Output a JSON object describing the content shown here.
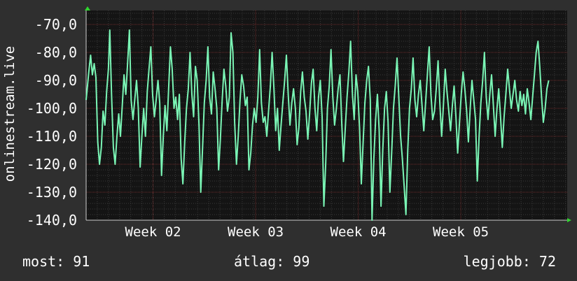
{
  "chart_data": {
    "type": "line",
    "ylabel": "onlinestream.live",
    "y_ticks": [
      -70,
      -80,
      -90,
      -100,
      -110,
      -120,
      -130,
      -140
    ],
    "y_tick_labels": [
      "-70,0",
      "-80,0",
      "-90,0",
      "-100,0",
      "-110,0",
      "-120,0",
      "-130,0",
      "-140,0"
    ],
    "ylim": [
      -140,
      -65
    ],
    "x_range": [
      0,
      100
    ],
    "x_ticks": [
      {
        "x": 15,
        "label": "Week 02"
      },
      {
        "x": 38,
        "label": "Week 03"
      },
      {
        "x": 61,
        "label": "Week 04"
      },
      {
        "x": 84,
        "label": "Week 05"
      }
    ],
    "grid": true,
    "series": [
      {
        "color": "#7af5b5",
        "points": [
          [
            0,
            -97
          ],
          [
            0.6,
            -87
          ],
          [
            1.0,
            -81
          ],
          [
            1.4,
            -88
          ],
          [
            1.8,
            -84
          ],
          [
            2.2,
            -89
          ],
          [
            2.6,
            -112
          ],
          [
            3.0,
            -120
          ],
          [
            3.4,
            -114
          ],
          [
            3.8,
            -101
          ],
          [
            4.2,
            -106
          ],
          [
            4.6,
            -94
          ],
          [
            5.0,
            -86
          ],
          [
            5.3,
            -72
          ],
          [
            5.7,
            -95
          ],
          [
            6.1,
            -114
          ],
          [
            6.5,
            -120
          ],
          [
            6.9,
            -110
          ],
          [
            7.3,
            -102
          ],
          [
            7.7,
            -110
          ],
          [
            8.1,
            -99
          ],
          [
            8.5,
            -88
          ],
          [
            8.9,
            -95
          ],
          [
            9.3,
            -84
          ],
          [
            9.7,
            -72
          ],
          [
            10.1,
            -97
          ],
          [
            10.5,
            -104
          ],
          [
            10.9,
            -97
          ],
          [
            11.3,
            -90
          ],
          [
            11.7,
            -100
          ],
          [
            12.1,
            -121
          ],
          [
            12.5,
            -110
          ],
          [
            12.9,
            -100
          ],
          [
            13.3,
            -110
          ],
          [
            13.7,
            -94
          ],
          [
            14.1,
            -86
          ],
          [
            14.5,
            -78
          ],
          [
            14.9,
            -95
          ],
          [
            15.3,
            -103
          ],
          [
            15.7,
            -97
          ],
          [
            16.1,
            -90
          ],
          [
            16.5,
            -98
          ],
          [
            16.9,
            -124
          ],
          [
            17.3,
            -110
          ],
          [
            17.7,
            -99
          ],
          [
            18.1,
            -108
          ],
          [
            18.5,
            -93
          ],
          [
            18.9,
            -78
          ],
          [
            19.3,
            -86
          ],
          [
            19.7,
            -100
          ],
          [
            20.1,
            -96
          ],
          [
            20.5,
            -104
          ],
          [
            20.9,
            -95
          ],
          [
            21.3,
            -118
          ],
          [
            21.7,
            -127
          ],
          [
            22.1,
            -112
          ],
          [
            22.5,
            -100
          ],
          [
            22.9,
            -93
          ],
          [
            23.3,
            -80
          ],
          [
            23.7,
            -95
          ],
          [
            24.1,
            -103
          ],
          [
            24.5,
            -85
          ],
          [
            24.9,
            -90
          ],
          [
            25.3,
            -106
          ],
          [
            25.7,
            -130
          ],
          [
            26.1,
            -114
          ],
          [
            26.5,
            -98
          ],
          [
            26.9,
            -90
          ],
          [
            27.3,
            -78
          ],
          [
            27.7,
            -96
          ],
          [
            28.1,
            -102
          ],
          [
            28.5,
            -87
          ],
          [
            28.9,
            -93
          ],
          [
            29.3,
            -100
          ],
          [
            29.7,
            -122
          ],
          [
            30.1,
            -111
          ],
          [
            30.5,
            -97
          ],
          [
            30.9,
            -86
          ],
          [
            31.3,
            -92
          ],
          [
            31.7,
            -101
          ],
          [
            32.1,
            -96
          ],
          [
            32.5,
            -73
          ],
          [
            32.9,
            -80
          ],
          [
            33.3,
            -105
          ],
          [
            33.7,
            -120
          ],
          [
            34.1,
            -110
          ],
          [
            34.5,
            -97
          ],
          [
            34.9,
            -88
          ],
          [
            35.3,
            -92
          ],
          [
            35.7,
            -99
          ],
          [
            36.1,
            -96
          ],
          [
            36.5,
            -122
          ],
          [
            36.9,
            -116
          ],
          [
            37.3,
            -106
          ],
          [
            37.7,
            -100
          ],
          [
            38.1,
            -105
          ],
          [
            38.5,
            -96
          ],
          [
            38.9,
            -79
          ],
          [
            39.3,
            -98
          ],
          [
            39.7,
            -105
          ],
          [
            40.1,
            -103
          ],
          [
            40.5,
            -110
          ],
          [
            40.9,
            -101
          ],
          [
            41.3,
            -92
          ],
          [
            41.7,
            -80
          ],
          [
            42.1,
            -93
          ],
          [
            42.5,
            -108
          ],
          [
            42.9,
            -100
          ],
          [
            43.3,
            -115
          ],
          [
            43.7,
            -106
          ],
          [
            44.1,
            -98
          ],
          [
            44.5,
            -90
          ],
          [
            44.9,
            -81
          ],
          [
            45.3,
            -95
          ],
          [
            45.7,
            -106
          ],
          [
            46.1,
            -98
          ],
          [
            46.5,
            -93
          ],
          [
            46.9,
            -100
          ],
          [
            47.3,
            -113
          ],
          [
            47.7,
            -107
          ],
          [
            48.1,
            -94
          ],
          [
            48.5,
            -87
          ],
          [
            48.9,
            -96
          ],
          [
            49.3,
            -101
          ],
          [
            49.7,
            -111
          ],
          [
            50.1,
            -102
          ],
          [
            50.5,
            -91
          ],
          [
            50.9,
            -86
          ],
          [
            51.3,
            -100
          ],
          [
            51.7,
            -108
          ],
          [
            52.1,
            -96
          ],
          [
            52.5,
            -90
          ],
          [
            52.9,
            -103
          ],
          [
            53.3,
            -135
          ],
          [
            53.7,
            -120
          ],
          [
            54.1,
            -100
          ],
          [
            54.5,
            -92
          ],
          [
            54.9,
            -79
          ],
          [
            55.3,
            -96
          ],
          [
            55.7,
            -106
          ],
          [
            56.1,
            -100
          ],
          [
            56.5,
            -93
          ],
          [
            56.9,
            -88
          ],
          [
            57.3,
            -105
          ],
          [
            57.7,
            -119
          ],
          [
            58.1,
            -107
          ],
          [
            58.5,
            -96
          ],
          [
            58.9,
            -87
          ],
          [
            59.3,
            -76
          ],
          [
            59.7,
            -95
          ],
          [
            60.1,
            -104
          ],
          [
            60.5,
            -88
          ],
          [
            60.9,
            -94
          ],
          [
            61.3,
            -107
          ],
          [
            61.7,
            -127
          ],
          [
            62.1,
            -112
          ],
          [
            62.5,
            -98
          ],
          [
            62.9,
            -90
          ],
          [
            63.3,
            -85
          ],
          [
            63.7,
            -97
          ],
          [
            64.1,
            -140
          ],
          [
            64.5,
            -118
          ],
          [
            64.9,
            -104
          ],
          [
            65.3,
            -95
          ],
          [
            65.7,
            -108
          ],
          [
            66.1,
            -135
          ],
          [
            66.5,
            -115
          ],
          [
            66.9,
            -100
          ],
          [
            67.3,
            -94
          ],
          [
            67.7,
            -105
          ],
          [
            68.1,
            -130
          ],
          [
            68.5,
            -116
          ],
          [
            68.9,
            -100
          ],
          [
            69.3,
            -92
          ],
          [
            69.7,
            -82
          ],
          [
            70.1,
            -96
          ],
          [
            70.5,
            -110
          ],
          [
            70.9,
            -118
          ],
          [
            71.3,
            -128
          ],
          [
            71.7,
            -138
          ],
          [
            72.1,
            -115
          ],
          [
            72.5,
            -100
          ],
          [
            72.9,
            -93
          ],
          [
            73.3,
            -82
          ],
          [
            73.7,
            -97
          ],
          [
            74.1,
            -103
          ],
          [
            74.5,
            -95
          ],
          [
            74.9,
            -90
          ],
          [
            75.3,
            -99
          ],
          [
            75.7,
            -108
          ],
          [
            76.1,
            -98
          ],
          [
            76.5,
            -88
          ],
          [
            76.9,
            -78
          ],
          [
            77.3,
            -95
          ],
          [
            77.7,
            -104
          ],
          [
            78.1,
            -101
          ],
          [
            78.5,
            -93
          ],
          [
            78.9,
            -83
          ],
          [
            79.3,
            -98
          ],
          [
            79.7,
            -110
          ],
          [
            80.1,
            -99
          ],
          [
            80.5,
            -86
          ],
          [
            80.9,
            -94
          ],
          [
            81.3,
            -101
          ],
          [
            81.7,
            -108
          ],
          [
            82.1,
            -99
          ],
          [
            82.5,
            -92
          ],
          [
            82.9,
            -103
          ],
          [
            83.3,
            -116
          ],
          [
            83.7,
            -105
          ],
          [
            84.1,
            -95
          ],
          [
            84.5,
            -87
          ],
          [
            84.9,
            -93
          ],
          [
            85.3,
            -101
          ],
          [
            85.7,
            -112
          ],
          [
            86.1,
            -100
          ],
          [
            86.5,
            -90
          ],
          [
            86.9,
            -97
          ],
          [
            87.3,
            -104
          ],
          [
            87.7,
            -126
          ],
          [
            88.1,
            -110
          ],
          [
            88.5,
            -98
          ],
          [
            88.9,
            -90
          ],
          [
            89.3,
            -80
          ],
          [
            89.7,
            -96
          ],
          [
            90.1,
            -104
          ],
          [
            90.5,
            -95
          ],
          [
            90.9,
            -88
          ],
          [
            91.3,
            -99
          ],
          [
            91.7,
            -110
          ],
          [
            92.1,
            -100
          ],
          [
            92.5,
            -93
          ],
          [
            92.9,
            -103
          ],
          [
            93.3,
            -114
          ],
          [
            93.7,
            -103
          ],
          [
            94.1,
            -95
          ],
          [
            94.5,
            -86
          ],
          [
            94.9,
            -93
          ],
          [
            95.3,
            -100
          ],
          [
            95.7,
            -95
          ],
          [
            96.1,
            -90
          ],
          [
            96.5,
            -97
          ],
          [
            96.9,
            -101
          ],
          [
            97.3,
            -94
          ],
          [
            97.7,
            -99
          ],
          [
            98.1,
            -95
          ],
          [
            98.5,
            -102
          ],
          [
            98.9,
            -93
          ],
          [
            99.3,
            -98
          ],
          [
            99.7,
            -104
          ],
          [
            100.1,
            -96
          ],
          [
            100.5,
            -88
          ],
          [
            100.9,
            -80
          ],
          [
            101.3,
            -76
          ],
          [
            101.7,
            -85
          ],
          [
            102.1,
            -96
          ],
          [
            102.5,
            -105
          ],
          [
            102.9,
            -100
          ],
          [
            103.3,
            -93
          ],
          [
            103.7,
            -90
          ]
        ]
      }
    ]
  },
  "stats": {
    "current": "most: 91",
    "average": "átlag: 99",
    "best": "legjobb: 72"
  },
  "colors": {
    "background": "#2f2f2f",
    "plot_background": "#141414",
    "grid_major": "#6e2a2a",
    "grid_minor": "#3a3a3a",
    "line": "#7af5b5",
    "text": "#ffffff",
    "axis_arrow": "#2fd62f"
  }
}
